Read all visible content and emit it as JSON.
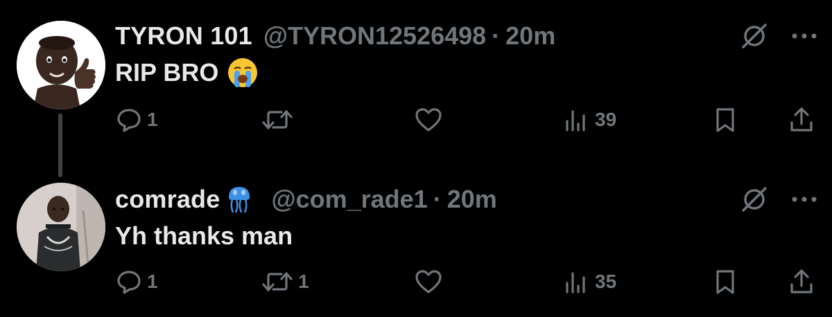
{
  "tweets": [
    {
      "name": "TYRON 101",
      "handle": "@TYRON12526498",
      "separator": "·",
      "time": "20m",
      "text": "RIP BRO",
      "text_emoji": "loudly-crying-face",
      "avatar": "memoji-thumbs-up",
      "replies": "1",
      "retweets": "",
      "likes": "",
      "views": "39"
    },
    {
      "name": "comrade",
      "name_emoji": "jellyfish",
      "handle": "@com_rade1",
      "separator": "·",
      "time": "20m",
      "text": "Yh thanks man",
      "avatar": "photo-person",
      "replies": "1",
      "retweets": "1",
      "likes": "",
      "views": "35"
    }
  ],
  "icons": {
    "reply": "speech-bubble-icon",
    "retweet": "retweet-icon",
    "like": "heart-icon",
    "views": "bar-chart-icon",
    "bookmark": "bookmark-icon",
    "share": "share-upload-icon",
    "grok": "grok-slash-circle-icon",
    "more": "more-dots-icon"
  },
  "colors": {
    "background": "#000000",
    "text_primary": "#e7e9ea",
    "text_secondary": "#71767b",
    "thread_line": "#3e4144"
  }
}
